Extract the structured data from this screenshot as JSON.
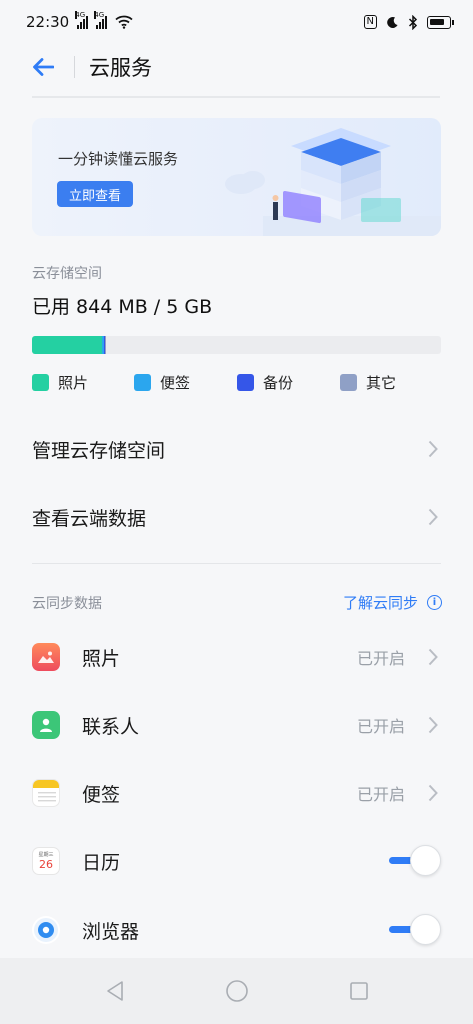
{
  "status": {
    "time": "22:30",
    "net1": "4G",
    "net2": "4G",
    "nfc": "N"
  },
  "header": {
    "title": "云服务"
  },
  "banner": {
    "text": "一分钟读懂云服务",
    "button": "立即查看"
  },
  "storage": {
    "label": "云存储空间",
    "used_text": "已用 844 MB / 5 GB",
    "used_mb": 844,
    "total_gb": 5,
    "segments": [
      {
        "name": "照片",
        "color": "#24d0a2",
        "fraction": 0.172
      },
      {
        "name": "便签",
        "color": "#2ba6ee",
        "fraction": 0.003
      },
      {
        "name": "备份",
        "color": "#3556e8",
        "fraction": 0.004
      },
      {
        "name": "其它",
        "color": "#8fa0c6",
        "fraction": 0.003
      }
    ]
  },
  "menu": {
    "manage": "管理云存储空间",
    "view_data": "查看云端数据"
  },
  "sync": {
    "label": "云同步数据",
    "learn": "了解云同步",
    "items": [
      {
        "name": "照片",
        "status": "已开启",
        "icon": "photos-icon"
      },
      {
        "name": "联系人",
        "status": "已开启",
        "icon": "contacts-icon"
      },
      {
        "name": "便签",
        "status": "已开启",
        "icon": "notes-icon"
      },
      {
        "name": "日历",
        "status": "",
        "icon": "calendar-icon",
        "toggle": true,
        "calendar_weekday": "星期三",
        "calendar_day": "26"
      },
      {
        "name": "浏览器",
        "status": "",
        "icon": "browser-icon",
        "toggle": true
      }
    ]
  },
  "colors": {
    "accent": "#2f7cf6",
    "photos_icon": "#f26e52",
    "contacts_icon": "#3cc678",
    "notes_icon": "#f7c624"
  }
}
